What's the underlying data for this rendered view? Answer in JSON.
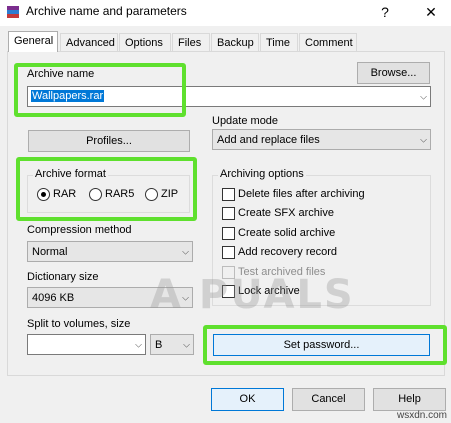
{
  "window": {
    "title": "Archive name and parameters",
    "help_button": "?",
    "close_button": "✕"
  },
  "tabs": [
    {
      "label": "General",
      "active": true
    },
    {
      "label": "Advanced"
    },
    {
      "label": "Options"
    },
    {
      "label": "Files"
    },
    {
      "label": "Backup"
    },
    {
      "label": "Time"
    },
    {
      "label": "Comment"
    }
  ],
  "archive_name": {
    "label": "Archive name",
    "value": "Wallpapers.rar",
    "browse_button": "Browse..."
  },
  "profiles_button": "Profiles...",
  "update_mode": {
    "label": "Update mode",
    "value": "Add and replace files"
  },
  "archive_format": {
    "label": "Archive format",
    "options": [
      "RAR",
      "RAR5",
      "ZIP"
    ],
    "selected": "RAR"
  },
  "compression_method": {
    "label": "Compression method",
    "value": "Normal"
  },
  "dictionary_size": {
    "label": "Dictionary size",
    "value": "4096 KB"
  },
  "split_volumes": {
    "label": "Split to volumes, size",
    "value": "",
    "unit": "B"
  },
  "archiving_options": {
    "label": "Archiving options",
    "items": [
      {
        "label": "Delete files after archiving",
        "checked": false,
        "enabled": true
      },
      {
        "label": "Create SFX archive",
        "checked": false,
        "enabled": true
      },
      {
        "label": "Create solid archive",
        "checked": false,
        "enabled": true
      },
      {
        "label": "Add recovery record",
        "checked": false,
        "enabled": true
      },
      {
        "label": "Test archived files",
        "checked": false,
        "enabled": false
      },
      {
        "label": "Lock archive",
        "checked": false,
        "enabled": true
      }
    ]
  },
  "set_password_button": "Set password...",
  "footer": {
    "ok": "OK",
    "cancel": "Cancel",
    "help": "Help"
  },
  "watermark": "A PUALS",
  "credit": "wsxdn.com",
  "colors": {
    "highlight": "#5fe02e",
    "selection": "#0078d7"
  }
}
